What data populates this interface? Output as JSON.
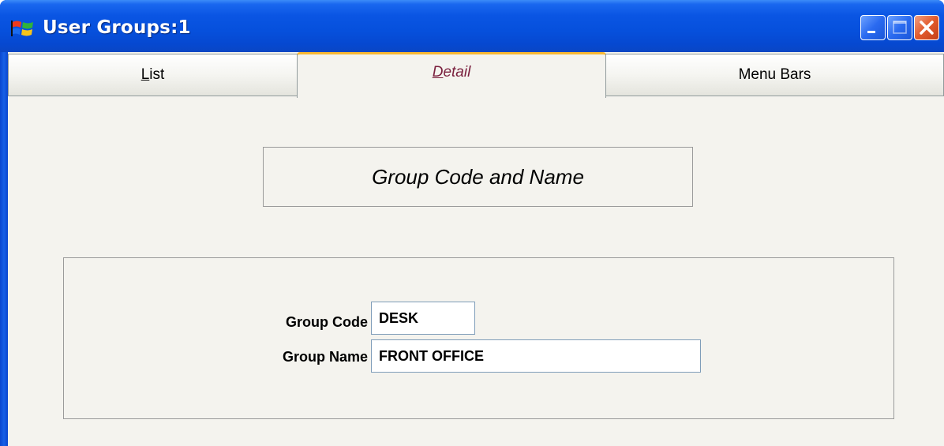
{
  "window": {
    "title": "User Groups:1",
    "app_icon": "windows-flag-icon"
  },
  "titlebar_buttons": {
    "minimize_icon": "minimize-icon",
    "maximize_icon": "maximize-icon",
    "close_icon": "close-icon"
  },
  "tabs": [
    {
      "label": "List",
      "selected": false
    },
    {
      "label": "Detail",
      "selected": true
    },
    {
      "label": "Menu Bars",
      "selected": false
    }
  ],
  "header": {
    "title": "Group Code and Name"
  },
  "form": {
    "group_code_label": "Group Code",
    "group_code_value": "DESK",
    "group_name_label": "Group Name",
    "group_name_value": "FRONT OFFICE"
  },
  "colors": {
    "titlebar": "#0650dc",
    "selected_tab_accent": "#f9b934",
    "selected_tab_text": "#7a1f3d",
    "background": "#f4f3ee",
    "close_button": "#e25a2b"
  }
}
